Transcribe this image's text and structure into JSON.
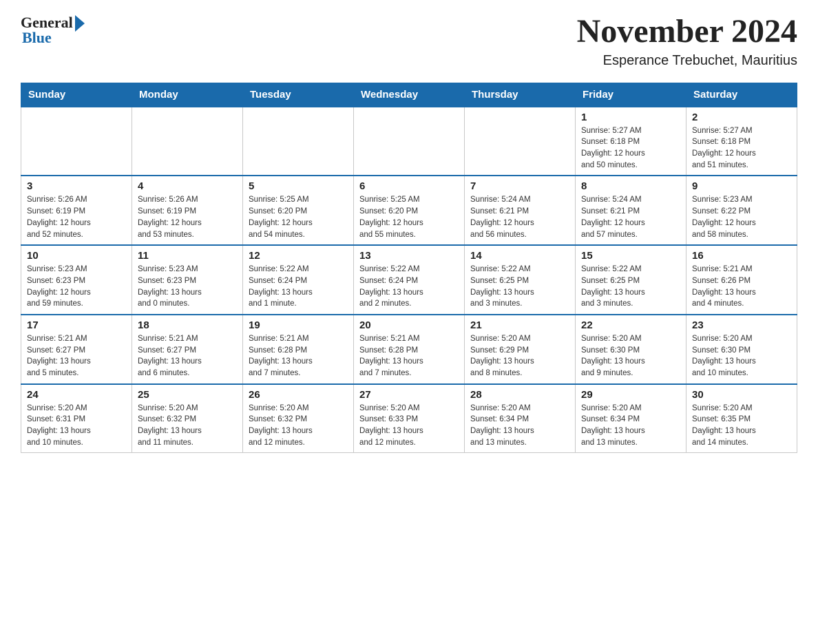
{
  "header": {
    "logo_general": "General",
    "logo_blue": "Blue",
    "month_title": "November 2024",
    "location": "Esperance Trebuchet, Mauritius"
  },
  "days_of_week": [
    "Sunday",
    "Monday",
    "Tuesday",
    "Wednesday",
    "Thursday",
    "Friday",
    "Saturday"
  ],
  "weeks": [
    [
      {
        "day": "",
        "info": ""
      },
      {
        "day": "",
        "info": ""
      },
      {
        "day": "",
        "info": ""
      },
      {
        "day": "",
        "info": ""
      },
      {
        "day": "",
        "info": ""
      },
      {
        "day": "1",
        "info": "Sunrise: 5:27 AM\nSunset: 6:18 PM\nDaylight: 12 hours\nand 50 minutes."
      },
      {
        "day": "2",
        "info": "Sunrise: 5:27 AM\nSunset: 6:18 PM\nDaylight: 12 hours\nand 51 minutes."
      }
    ],
    [
      {
        "day": "3",
        "info": "Sunrise: 5:26 AM\nSunset: 6:19 PM\nDaylight: 12 hours\nand 52 minutes."
      },
      {
        "day": "4",
        "info": "Sunrise: 5:26 AM\nSunset: 6:19 PM\nDaylight: 12 hours\nand 53 minutes."
      },
      {
        "day": "5",
        "info": "Sunrise: 5:25 AM\nSunset: 6:20 PM\nDaylight: 12 hours\nand 54 minutes."
      },
      {
        "day": "6",
        "info": "Sunrise: 5:25 AM\nSunset: 6:20 PM\nDaylight: 12 hours\nand 55 minutes."
      },
      {
        "day": "7",
        "info": "Sunrise: 5:24 AM\nSunset: 6:21 PM\nDaylight: 12 hours\nand 56 minutes."
      },
      {
        "day": "8",
        "info": "Sunrise: 5:24 AM\nSunset: 6:21 PM\nDaylight: 12 hours\nand 57 minutes."
      },
      {
        "day": "9",
        "info": "Sunrise: 5:23 AM\nSunset: 6:22 PM\nDaylight: 12 hours\nand 58 minutes."
      }
    ],
    [
      {
        "day": "10",
        "info": "Sunrise: 5:23 AM\nSunset: 6:23 PM\nDaylight: 12 hours\nand 59 minutes."
      },
      {
        "day": "11",
        "info": "Sunrise: 5:23 AM\nSunset: 6:23 PM\nDaylight: 13 hours\nand 0 minutes."
      },
      {
        "day": "12",
        "info": "Sunrise: 5:22 AM\nSunset: 6:24 PM\nDaylight: 13 hours\nand 1 minute."
      },
      {
        "day": "13",
        "info": "Sunrise: 5:22 AM\nSunset: 6:24 PM\nDaylight: 13 hours\nand 2 minutes."
      },
      {
        "day": "14",
        "info": "Sunrise: 5:22 AM\nSunset: 6:25 PM\nDaylight: 13 hours\nand 3 minutes."
      },
      {
        "day": "15",
        "info": "Sunrise: 5:22 AM\nSunset: 6:25 PM\nDaylight: 13 hours\nand 3 minutes."
      },
      {
        "day": "16",
        "info": "Sunrise: 5:21 AM\nSunset: 6:26 PM\nDaylight: 13 hours\nand 4 minutes."
      }
    ],
    [
      {
        "day": "17",
        "info": "Sunrise: 5:21 AM\nSunset: 6:27 PM\nDaylight: 13 hours\nand 5 minutes."
      },
      {
        "day": "18",
        "info": "Sunrise: 5:21 AM\nSunset: 6:27 PM\nDaylight: 13 hours\nand 6 minutes."
      },
      {
        "day": "19",
        "info": "Sunrise: 5:21 AM\nSunset: 6:28 PM\nDaylight: 13 hours\nand 7 minutes."
      },
      {
        "day": "20",
        "info": "Sunrise: 5:21 AM\nSunset: 6:28 PM\nDaylight: 13 hours\nand 7 minutes."
      },
      {
        "day": "21",
        "info": "Sunrise: 5:20 AM\nSunset: 6:29 PM\nDaylight: 13 hours\nand 8 minutes."
      },
      {
        "day": "22",
        "info": "Sunrise: 5:20 AM\nSunset: 6:30 PM\nDaylight: 13 hours\nand 9 minutes."
      },
      {
        "day": "23",
        "info": "Sunrise: 5:20 AM\nSunset: 6:30 PM\nDaylight: 13 hours\nand 10 minutes."
      }
    ],
    [
      {
        "day": "24",
        "info": "Sunrise: 5:20 AM\nSunset: 6:31 PM\nDaylight: 13 hours\nand 10 minutes."
      },
      {
        "day": "25",
        "info": "Sunrise: 5:20 AM\nSunset: 6:32 PM\nDaylight: 13 hours\nand 11 minutes."
      },
      {
        "day": "26",
        "info": "Sunrise: 5:20 AM\nSunset: 6:32 PM\nDaylight: 13 hours\nand 12 minutes."
      },
      {
        "day": "27",
        "info": "Sunrise: 5:20 AM\nSunset: 6:33 PM\nDaylight: 13 hours\nand 12 minutes."
      },
      {
        "day": "28",
        "info": "Sunrise: 5:20 AM\nSunset: 6:34 PM\nDaylight: 13 hours\nand 13 minutes."
      },
      {
        "day": "29",
        "info": "Sunrise: 5:20 AM\nSunset: 6:34 PM\nDaylight: 13 hours\nand 13 minutes."
      },
      {
        "day": "30",
        "info": "Sunrise: 5:20 AM\nSunset: 6:35 PM\nDaylight: 13 hours\nand 14 minutes."
      }
    ]
  ]
}
